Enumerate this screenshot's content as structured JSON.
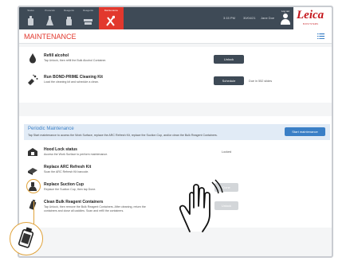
{
  "nav": {
    "items": [
      {
        "label": "Status",
        "icon": "reagent-bottle-icon"
      },
      {
        "label": "Protocols",
        "icon": "flask-icon"
      },
      {
        "label": "Reagents",
        "icon": "bottle-icon"
      },
      {
        "label": "Reagents",
        "icon": "slide-tray-icon"
      },
      {
        "label": "Maintenance",
        "icon": "tools-icon",
        "active": true
      }
    ],
    "time": "3:15 PM",
    "date": "30/04/21",
    "user": "Jane Doe",
    "login_label": "Log out"
  },
  "brand": {
    "logo": "Leica",
    "sub": "BIOSYSTEMS",
    "color": "#c4161c"
  },
  "page": {
    "title": "MAINTENANCE",
    "accent": "#e2382d"
  },
  "tasks": [
    {
      "title": "Refill alcohol",
      "desc": "Tap Unlock, then refill the Bulk Alcohol Container.",
      "button": "Unlock",
      "icon": "alcohol-drop-icon"
    },
    {
      "title": "Run BOND-PRIME Cleaning Kit",
      "desc": "Load the cleaning kit and schedule a clean.",
      "button": "Schedule",
      "note": "Due in 552 slides",
      "icon": "cleaning-kit-icon"
    }
  ],
  "periodic": {
    "title": "Periodic Maintenance",
    "desc": "Tap Start maintenance to access the Work Surface, replace the ARC Refresh Kit, replace the Suction Cup, and/or clean the Bulk Reagent Containers.",
    "button": "Start maintenance",
    "items": [
      {
        "title": "Hood Lock status",
        "desc": "Access the Work Surface to perform maintenance.",
        "status": "Locked",
        "icon": "hood-lock-icon"
      },
      {
        "title": "Replace ARC Refresh Kit",
        "desc": "Scan the ARC Refresh Kit barcode.",
        "icon": "arc-kit-icon"
      },
      {
        "title": "Replace Suction Cup",
        "desc": "Replace the Suction Cup, then tap Done.",
        "button": "Done",
        "icon": "suction-cup-icon"
      },
      {
        "title": "Clean Bulk Reagent Containers",
        "desc": "Tap Unlock, then remove the Bulk Reagent Containers. After cleaning, return the",
        "desc2": "containers and close all caddies. Scan and refill the containers.",
        "button": "Unlock",
        "icon": "reagent-container-icon"
      }
    ]
  }
}
